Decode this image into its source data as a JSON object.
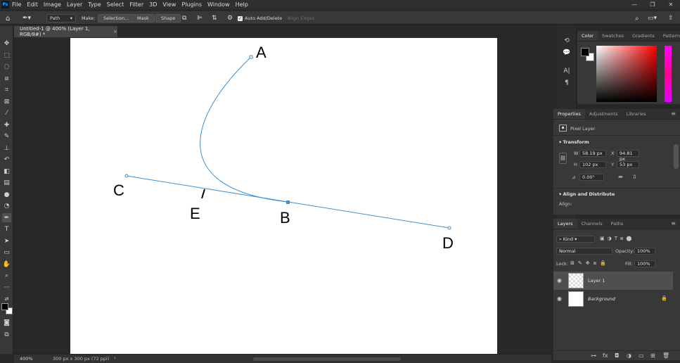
{
  "menu": {
    "logo": "Ps",
    "items": [
      "File",
      "Edit",
      "Image",
      "Layer",
      "Type",
      "Select",
      "Filter",
      "3D",
      "View",
      "Plugins",
      "Window",
      "Help"
    ],
    "window_controls": [
      "—",
      "❐",
      "✕"
    ]
  },
  "options": {
    "mode": "Path",
    "make_label": "Make:",
    "selection": "Selection...",
    "mask": "Mask",
    "shape": "Shape",
    "auto_add": "Auto Add/Delete",
    "align_edges": "Align Edges"
  },
  "document": {
    "tab_title": "Untitled-1 @ 400% (Layer 1, RGB/8#) *",
    "tab_close": "×",
    "anchors": {
      "A": "A",
      "B": "B",
      "C": "C",
      "D": "D",
      "E": "E"
    },
    "path_color": "#3c8fd0"
  },
  "status": {
    "zoom": "400%",
    "doc_size": "300 px x 300 px (72 ppi)",
    "arrow": "›"
  },
  "color_panel": {
    "tabs": [
      "Color",
      "Swatches",
      "Gradients",
      "Patterns"
    ],
    "active": "Color",
    "fg": "#000000",
    "bg": "#ffffff"
  },
  "properties": {
    "tabs": [
      "Properties",
      "Adjustments",
      "Libraries"
    ],
    "layer_type": "Pixel Layer",
    "transform_title": "Transform",
    "w_label": "W",
    "w": "58.19 px",
    "h_label": "H",
    "h": "102 px",
    "x_label": "X",
    "x": "94.81 px",
    "y_label": "Y",
    "y": "53 px",
    "angle": "0.00°",
    "align_title": "Align and Distribute",
    "align_label": "Align:"
  },
  "layers": {
    "tabs": [
      "Layers",
      "Channels",
      "Paths"
    ],
    "kind": "Kind",
    "blend": "Normal",
    "opacity_label": "Opacity:",
    "opacity": "100%",
    "lock_label": "Lock:",
    "fill_label": "Fill:",
    "fill": "100%",
    "rows": [
      {
        "name": "Layer 1",
        "selected": true
      },
      {
        "name": "Background",
        "selected": false
      }
    ]
  }
}
